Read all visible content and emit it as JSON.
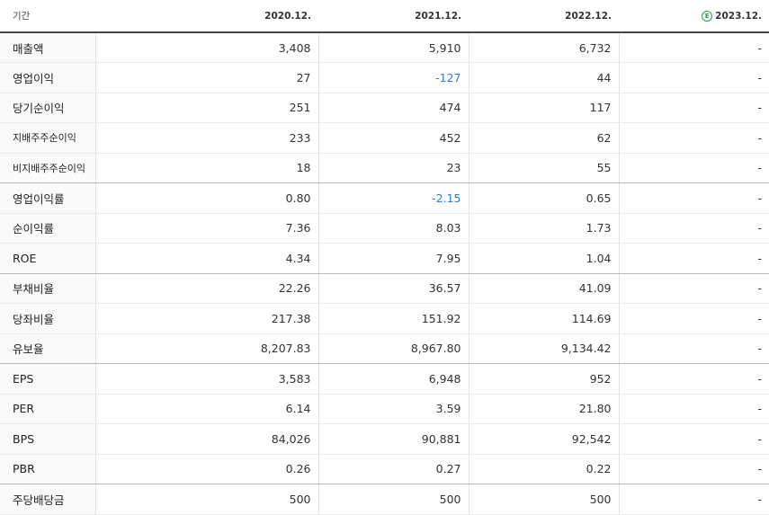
{
  "header": {
    "period_label": "기간",
    "columns": [
      "2020.12.",
      "2021.12.",
      "2022.12.",
      "2023.12."
    ],
    "estimate_badge": "E"
  },
  "rows": [
    {
      "label": "매출액",
      "values": [
        "3,408",
        "5,910",
        "6,732",
        "-"
      ]
    },
    {
      "label": "영업이익",
      "values": [
        "27",
        "-127",
        "44",
        "-"
      ]
    },
    {
      "label": "당기순이익",
      "values": [
        "251",
        "474",
        "117",
        "-"
      ]
    },
    {
      "label": "지배주주순이익",
      "values": [
        "233",
        "452",
        "62",
        "-"
      ]
    },
    {
      "label": "비지배주주순이익",
      "values": [
        "18",
        "23",
        "55",
        "-"
      ]
    },
    {
      "label": "영업이익률",
      "values": [
        "0.80",
        "-2.15",
        "0.65",
        "-"
      ]
    },
    {
      "label": "순이익률",
      "values": [
        "7.36",
        "8.03",
        "1.73",
        "-"
      ]
    },
    {
      "label": "ROE",
      "values": [
        "4.34",
        "7.95",
        "1.04",
        "-"
      ]
    },
    {
      "label": "부채비율",
      "values": [
        "22.26",
        "36.57",
        "41.09",
        "-"
      ]
    },
    {
      "label": "당좌비율",
      "values": [
        "217.38",
        "151.92",
        "114.69",
        "-"
      ]
    },
    {
      "label": "유보율",
      "values": [
        "8,207.83",
        "8,967.80",
        "9,134.42",
        "-"
      ]
    },
    {
      "label": "EPS",
      "values": [
        "3,583",
        "6,948",
        "952",
        "-"
      ]
    },
    {
      "label": "PER",
      "values": [
        "6.14",
        "3.59",
        "21.80",
        "-"
      ]
    },
    {
      "label": "BPS",
      "values": [
        "84,026",
        "90,881",
        "92,542",
        "-"
      ]
    },
    {
      "label": "PBR",
      "values": [
        "0.26",
        "0.27",
        "0.22",
        "-"
      ]
    },
    {
      "label": "주당배당금",
      "values": [
        "500",
        "500",
        "500",
        "-"
      ]
    }
  ],
  "colors": {
    "negative": "#2e7ed6",
    "estimate": "#1aa34a"
  }
}
